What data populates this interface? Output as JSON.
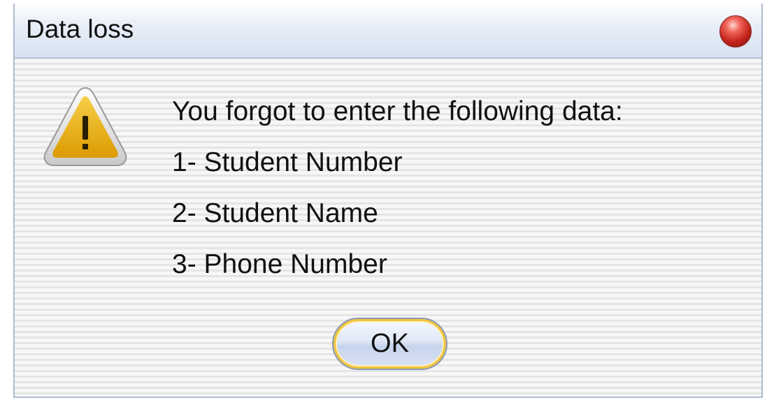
{
  "dialog": {
    "title": "Data loss",
    "close_icon": "close-icon",
    "warning_icon": "warning-icon",
    "message_lines": [
      "You forgot to enter the following data:",
      "1- Student Number",
      "2- Student Name",
      "3- Phone Number"
    ],
    "ok_label": "OK"
  },
  "colors": {
    "titlebar": "#d7e1f0",
    "close_button": "#c2231b",
    "warning_fill": "#e6a800",
    "button_focus_ring": "#f1c33a"
  }
}
